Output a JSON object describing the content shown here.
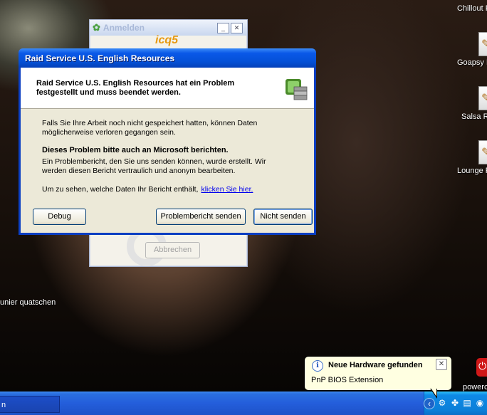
{
  "desktop": {
    "left_text": "unier quatschen",
    "right_labels": [
      "Chillout R",
      "Goapsy R",
      "Salsa Ra",
      "Lounge R"
    ],
    "power_label": "powerc"
  },
  "icq": {
    "title": "Anmelden",
    "logo": "icq5",
    "minimize": "_",
    "close": "✕",
    "cancel_label": "Abbrechen"
  },
  "dialog": {
    "title": "Raid Service U.S. English Resources",
    "header_text": "Raid Service U.S. English Resources hat ein Problem festgestellt und muss beendet werden.",
    "para1": "Falls Sie Ihre Arbeit noch nicht gespeichert hatten, können Daten möglicherweise verloren gegangen sein.",
    "para2_heading": "Dieses Problem bitte auch an Microsoft berichten.",
    "para2": "Ein Problembericht, den Sie uns senden können, wurde erstellt. Wir werden diesen Bericht vertraulich und anonym bearbeiten.",
    "para3": "Um zu sehen, welche Daten Ihr Bericht enthält,",
    "link": "klicken Sie hier.",
    "buttons": {
      "debug": "Debug",
      "send": "Problembericht senden",
      "dont_send": "Nicht senden"
    }
  },
  "taskbar": {
    "task_label": "n"
  },
  "balloon": {
    "icon": "i",
    "title": "Neue Hardware gefunden",
    "text": "PnP BIOS Extension",
    "close": "✕"
  }
}
